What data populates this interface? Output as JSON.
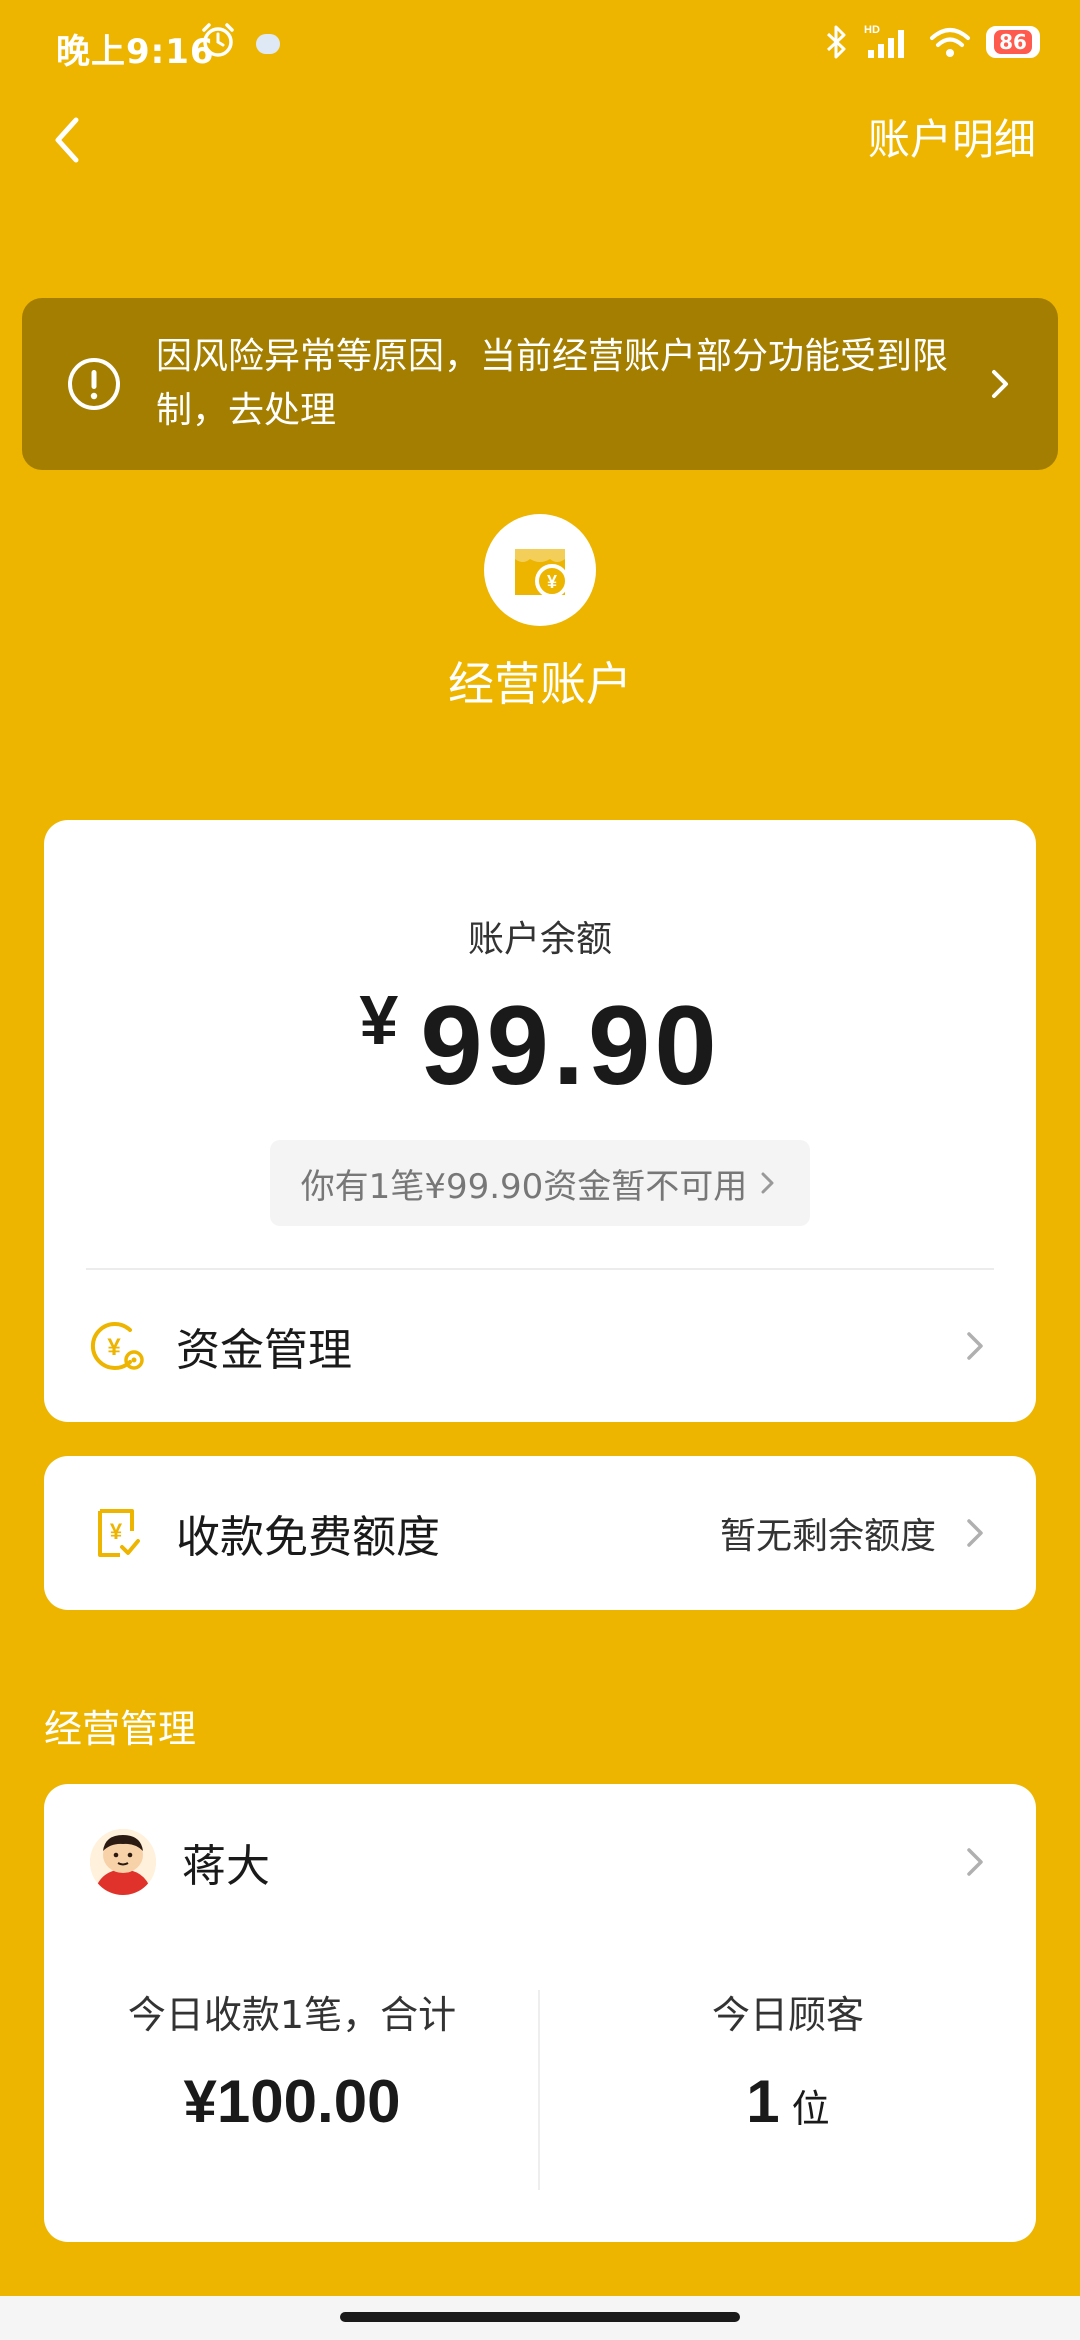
{
  "status_bar": {
    "time": "晚上9:16",
    "battery": "86"
  },
  "header": {
    "back_icon": "chevron-left-icon",
    "right_link": "账户明细"
  },
  "risk_banner": {
    "icon": "warning-circle-icon",
    "text": "因风险异常等原因，当前经营账户部分功能受到限制，去处理"
  },
  "account": {
    "icon": "store-wallet-icon",
    "title": "经营账户"
  },
  "balance_card": {
    "label": "账户余额",
    "currency": "¥",
    "amount": "99.90",
    "notice": "你有1笔¥99.90资金暂不可用",
    "fund_management_label": "资金管理"
  },
  "quota_card": {
    "label": "收款免费额度",
    "value": "暂无剩余额度"
  },
  "business": {
    "section_title": "经营管理",
    "merchant_name": "蒋大",
    "today_income_label": "今日收款1笔，合计",
    "today_income_value": "¥100.00",
    "today_customers_label": "今日顾客",
    "today_customers_value": "1",
    "today_customers_unit": "位"
  },
  "colors": {
    "background": "#EDB500",
    "banner": "#A47E00",
    "accent_icon": "#EDB500"
  }
}
